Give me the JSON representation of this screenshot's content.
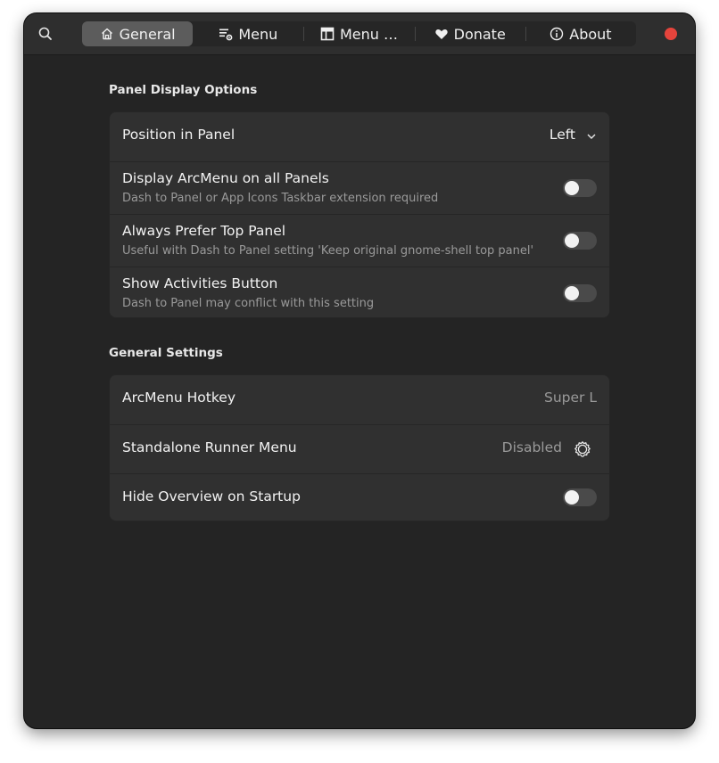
{
  "header": {
    "tabs": [
      {
        "label": "General",
        "icon": "home-icon"
      },
      {
        "label": "Menu",
        "icon": "menu-settings-icon"
      },
      {
        "label": "Menu …",
        "icon": "layout-icon"
      },
      {
        "label": "Donate",
        "icon": "heart-icon"
      },
      {
        "label": "About",
        "icon": "info-icon"
      }
    ],
    "active_tab": "General",
    "close_color": "#e5443c"
  },
  "panel_display": {
    "title": "Panel Display Options",
    "position": {
      "label": "Position in Panel",
      "value": "Left"
    },
    "all_panels": {
      "label": "Display ArcMenu on all Panels",
      "sub": "Dash to Panel or App Icons Taskbar extension required",
      "enabled": false
    },
    "top_panel": {
      "label": "Always Prefer Top Panel",
      "sub": "Useful with Dash to Panel setting 'Keep original gnome-shell top panel'",
      "enabled": false
    },
    "activities": {
      "label": "Show Activities Button",
      "sub": "Dash to Panel may conflict with this setting",
      "enabled": false
    }
  },
  "general_settings": {
    "title": "General Settings",
    "hotkey": {
      "label": "ArcMenu Hotkey",
      "value": "Super L"
    },
    "runner": {
      "label": "Standalone Runner Menu",
      "value": "Disabled"
    },
    "hide_overview": {
      "label": "Hide Overview on Startup",
      "enabled": false
    }
  }
}
